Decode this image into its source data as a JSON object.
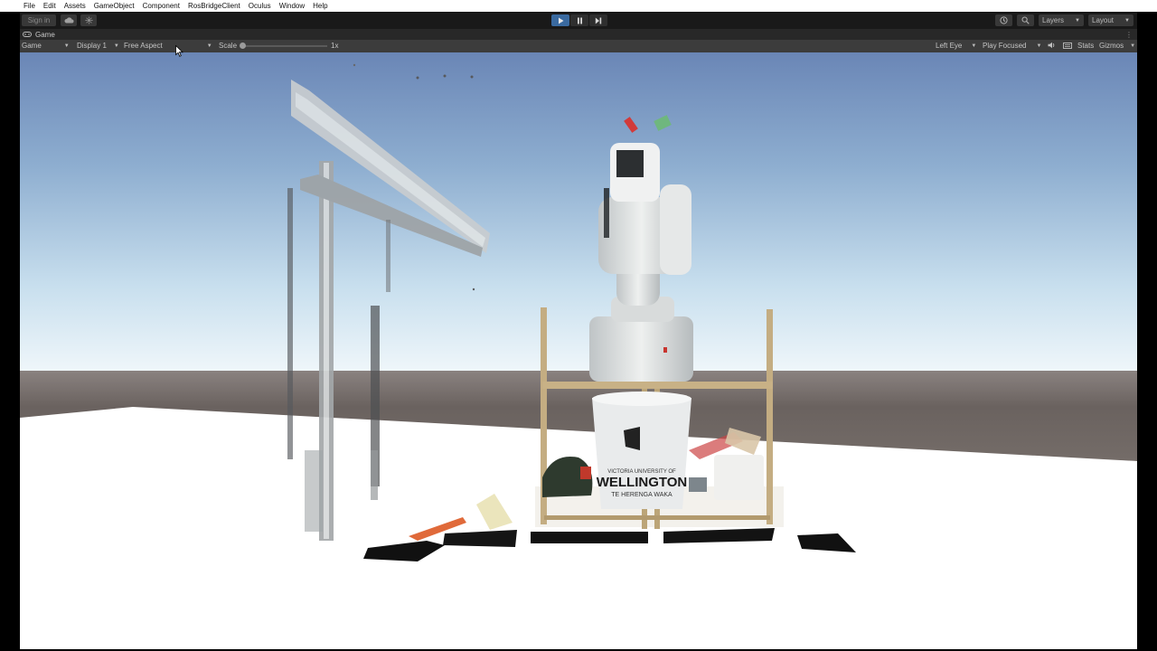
{
  "menu": [
    "File",
    "Edit",
    "Assets",
    "GameObject",
    "Component",
    "RosBridgeClient",
    "Oculus",
    "Window",
    "Help"
  ],
  "toolbar": {
    "sign_in": "Sign in",
    "layers": "Layers",
    "layout": "Layout"
  },
  "tab": {
    "game": "Game"
  },
  "gamebar": {
    "view": "Game",
    "display": "Display 1",
    "aspect": "Free Aspect",
    "scale_label": "Scale",
    "scale_value": "1x",
    "eye": "Left Eye",
    "play_mode": "Play Focused",
    "stats": "Stats",
    "gizmos": "Gizmos"
  },
  "scene": {
    "bucket_text_top": "VICTORIA UNIVERSITY OF",
    "bucket_text_main": "WELLINGTON",
    "bucket_text_sub": "TE HERENGA WAKA"
  },
  "colors": {
    "accent_play": "#3a6aa0",
    "sky_top": "#6f8ab8",
    "sky_horizon": "#eef6fa",
    "horizon_band": "#6b625e",
    "floor": "#ffffff"
  }
}
